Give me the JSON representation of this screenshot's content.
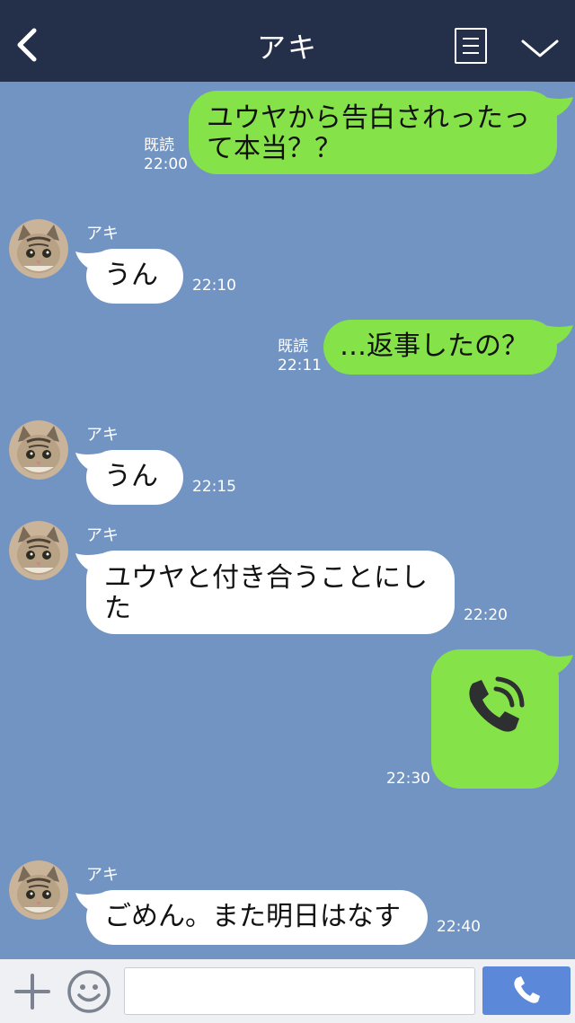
{
  "header": {
    "title": "アキ"
  },
  "messages": [
    {
      "sender": "me",
      "lines": [
        "ユウヤから告白されったっ",
        "て本当？？"
      ],
      "read": "既読",
      "time": "22:00"
    },
    {
      "sender": "them",
      "name": "アキ",
      "lines": [
        "うん"
      ],
      "time": "22:10"
    },
    {
      "sender": "me",
      "lines": [
        "…返事したの？"
      ],
      "read": "既読",
      "time": "22:11"
    },
    {
      "sender": "them",
      "name": "アキ",
      "lines": [
        "うん"
      ],
      "time": "22:15"
    },
    {
      "sender": "them",
      "name": "アキ",
      "lines": [
        "ユウヤと付き合うことにし",
        "た"
      ],
      "time": "22:20"
    },
    {
      "sender": "me",
      "type": "call",
      "icon": "phone-call-icon",
      "time": "22:30"
    },
    {
      "sender": "them",
      "name": "アキ",
      "lines": [
        "ごめん。また明日はなす"
      ],
      "time": "22:40"
    }
  ],
  "composer": {
    "placeholder": ""
  },
  "colors": {
    "header": "#242f4a",
    "background": "#7294c3",
    "my_bubble": "#85e249",
    "their_bubble": "#ffffff",
    "send_button": "#5b88d8"
  }
}
